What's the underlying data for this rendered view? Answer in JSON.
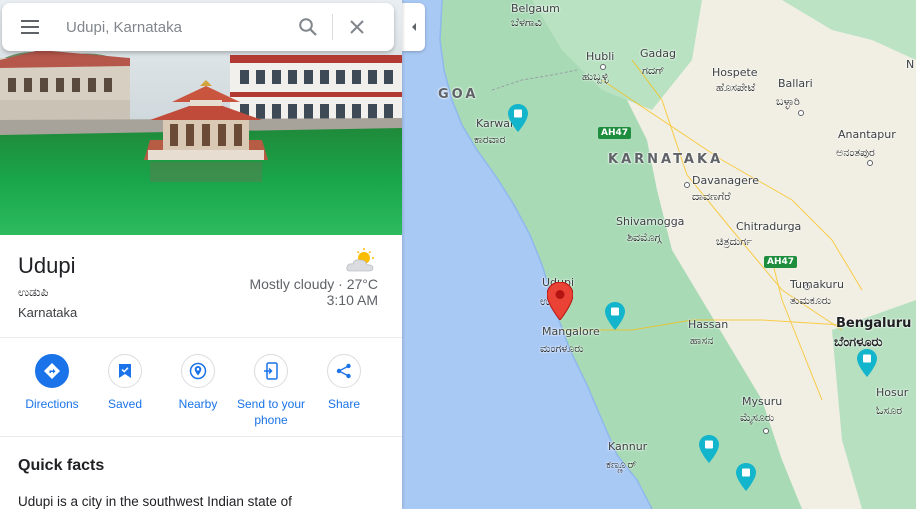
{
  "search": {
    "placeholder": "Udupi, Karnataka"
  },
  "icons": {
    "menu": "menu-icon",
    "search": "search-icon",
    "close": "close-icon",
    "collapse": "chevron-left-icon",
    "weather": "partly-cloudy-icon"
  },
  "place": {
    "title": "Udupi",
    "local_name": "ಉಡುಪಿ",
    "region": "Karnataka",
    "weather": "Mostly cloudy · 27°C",
    "time": "3:10 AM"
  },
  "actions": [
    {
      "label": "Directions",
      "icon": "directions-icon"
    },
    {
      "label": "Saved",
      "icon": "bookmark-icon"
    },
    {
      "label": "Nearby",
      "icon": "nearby-icon"
    },
    {
      "label": "Send to your phone",
      "icon": "send-to-phone-icon"
    },
    {
      "label": "Share",
      "icon": "share-icon"
    }
  ],
  "quick_facts": {
    "title": "Quick facts",
    "text": "Udupi is a city in the southwest Indian state of"
  },
  "map": {
    "labels": {
      "belgaum": "Belgaum",
      "belgaum_kn": "ಬೆಳಗಾವಿ",
      "hubli": "Hubli",
      "hubli_kn": "ಹುಬ್ಬಳ್ಳಿ",
      "gadag": "Gadag",
      "gadag_kn": "ಗದಗ್",
      "hospete": "Hospete",
      "hospete_kn": "ಹೊಸಪೇಟೆ",
      "ballari": "Ballari",
      "ballari_kn": "ಬಳ್ಳಾರಿ",
      "goa": "GOA",
      "karwar": "Karwar",
      "karwar_kn": "ಕಾರವಾರ",
      "karnataka": "KARNATAKA",
      "anantapur": "Anantapur",
      "anantapur_kn": "ಅನಂತಪುರ",
      "davanagere": "Davanagere",
      "davanagere_kn": "ದಾವಣಗೆರೆ",
      "shivamogga": "Shivamogga",
      "shivamogga_kn": "ಶಿವಮೊಗ್ಗ",
      "chitradurga": "Chitradurga",
      "chitradurga_kn": "ಚಿತ್ರದುರ್ಗ",
      "tumakuru": "Tumakuru",
      "tumakuru_kn": "ತುಮಕೂರು",
      "udupi": "Udupi",
      "udupi_kn": "ಉಡುಪಿ",
      "mangalore": "Mangalore",
      "mangalore_kn": "ಮಂಗಳೂರು",
      "hassan": "Hassan",
      "hassan_kn": "ಹಾಸನ",
      "bengaluru": "Bengaluru",
      "bengaluru_kn": "ಬೆಂಗಳೂರು",
      "hosur": "Hosur",
      "hosur_kn": "ಓಸೂರ",
      "mysuru": "Mysuru",
      "mysuru_kn": "ಮೈಸೂರು",
      "kannur": "Kannur",
      "kannur_kn": "ಕಣ್ಣೂರ್",
      "highway1": "AH47",
      "highway2": "AH47",
      "edge_n": "N"
    },
    "colors": {
      "sea": "#a9c9f5",
      "land_green": "#a8dab5",
      "land_dry": "#f1efe4",
      "pin_red": "#ea4335",
      "pin_teal": "#12b5cb"
    }
  }
}
